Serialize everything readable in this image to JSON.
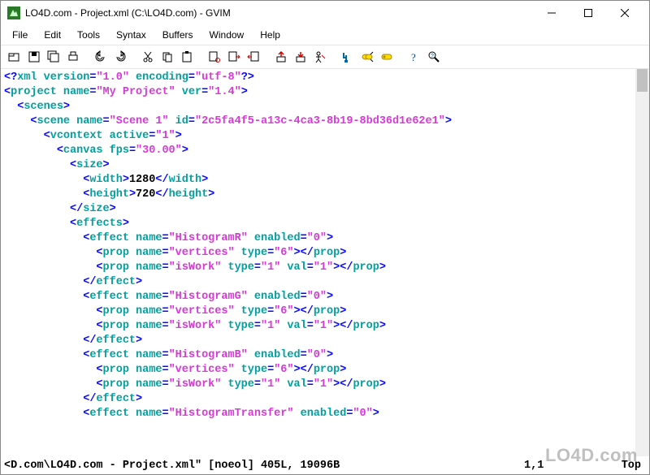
{
  "window": {
    "title": "LO4D.com - Project.xml (C:\\LO4D.com) - GVIM"
  },
  "menus": [
    "File",
    "Edit",
    "Tools",
    "Syntax",
    "Buffers",
    "Window",
    "Help"
  ],
  "toolbar_icons": [
    "open-file",
    "save-file",
    "save-all",
    "print",
    "sep",
    "undo",
    "redo",
    "sep",
    "cut",
    "copy",
    "paste",
    "sep",
    "find-replace",
    "find-next",
    "find-prev",
    "sep",
    "load-session",
    "save-session",
    "run-script",
    "sep",
    "build",
    "make-tags",
    "tag-jump",
    "sep",
    "help",
    "find-help"
  ],
  "code": {
    "lines": [
      {
        "indent": 0,
        "tokens": [
          [
            "pun",
            "<?"
          ],
          [
            "kw",
            "xml version"
          ],
          [
            "pun",
            "="
          ],
          [
            "str",
            "\"1.0\""
          ],
          [
            "kw",
            " encoding"
          ],
          [
            "pun",
            "="
          ],
          [
            "str",
            "\"utf-8\""
          ],
          [
            "pun",
            "?>"
          ]
        ]
      },
      {
        "indent": 0,
        "tokens": [
          [
            "pun",
            "<"
          ],
          [
            "kw",
            "project name"
          ],
          [
            "pun",
            "="
          ],
          [
            "str",
            "\"My Project\""
          ],
          [
            "kw",
            " ver"
          ],
          [
            "pun",
            "="
          ],
          [
            "str",
            "\"1.4\""
          ],
          [
            "pun",
            ">"
          ]
        ]
      },
      {
        "indent": 1,
        "tokens": [
          [
            "pun",
            "<"
          ],
          [
            "kw",
            "scenes"
          ],
          [
            "pun",
            ">"
          ]
        ]
      },
      {
        "indent": 2,
        "tokens": [
          [
            "pun",
            "<"
          ],
          [
            "kw",
            "scene name"
          ],
          [
            "pun",
            "="
          ],
          [
            "str",
            "\"Scene 1\""
          ],
          [
            "kw",
            " id"
          ],
          [
            "pun",
            "="
          ],
          [
            "str",
            "\"2c5fa4f5-a13c-4ca3-8b19-8bd36d1e62e1\""
          ],
          [
            "pun",
            ">"
          ]
        ]
      },
      {
        "indent": 3,
        "tokens": [
          [
            "pun",
            "<"
          ],
          [
            "kw",
            "vcontext active"
          ],
          [
            "pun",
            "="
          ],
          [
            "str",
            "\"1\""
          ],
          [
            "pun",
            ">"
          ]
        ]
      },
      {
        "indent": 4,
        "tokens": [
          [
            "pun",
            "<"
          ],
          [
            "kw",
            "canvas fps"
          ],
          [
            "pun",
            "="
          ],
          [
            "str",
            "\"30.00\""
          ],
          [
            "pun",
            ">"
          ]
        ]
      },
      {
        "indent": 5,
        "tokens": [
          [
            "pun",
            "<"
          ],
          [
            "kw",
            "size"
          ],
          [
            "pun",
            ">"
          ]
        ]
      },
      {
        "indent": 6,
        "tokens": [
          [
            "pun",
            "<"
          ],
          [
            "kw",
            "width"
          ],
          [
            "pun",
            ">"
          ],
          [
            "txt",
            "1280"
          ],
          [
            "pun",
            "</"
          ],
          [
            "kw",
            "width"
          ],
          [
            "pun",
            ">"
          ]
        ]
      },
      {
        "indent": 6,
        "tokens": [
          [
            "pun",
            "<"
          ],
          [
            "kw",
            "height"
          ],
          [
            "pun",
            ">"
          ],
          [
            "txt",
            "720"
          ],
          [
            "pun",
            "</"
          ],
          [
            "kw",
            "height"
          ],
          [
            "pun",
            ">"
          ]
        ]
      },
      {
        "indent": 5,
        "tokens": [
          [
            "pun",
            "</"
          ],
          [
            "kw",
            "size"
          ],
          [
            "pun",
            ">"
          ]
        ]
      },
      {
        "indent": 5,
        "tokens": [
          [
            "pun",
            "<"
          ],
          [
            "kw",
            "effects"
          ],
          [
            "pun",
            ">"
          ]
        ]
      },
      {
        "indent": 6,
        "tokens": [
          [
            "pun",
            "<"
          ],
          [
            "kw",
            "effect name"
          ],
          [
            "pun",
            "="
          ],
          [
            "str",
            "\"HistogramR\""
          ],
          [
            "kw",
            " enabled"
          ],
          [
            "pun",
            "="
          ],
          [
            "str",
            "\"0\""
          ],
          [
            "pun",
            ">"
          ]
        ]
      },
      {
        "indent": 7,
        "tokens": [
          [
            "pun",
            "<"
          ],
          [
            "kw",
            "prop name"
          ],
          [
            "pun",
            "="
          ],
          [
            "str",
            "\"vertices\""
          ],
          [
            "kw",
            " type"
          ],
          [
            "pun",
            "="
          ],
          [
            "str",
            "\"6\""
          ],
          [
            "pun",
            "></"
          ],
          [
            "kw",
            "prop"
          ],
          [
            "pun",
            ">"
          ]
        ]
      },
      {
        "indent": 7,
        "tokens": [
          [
            "pun",
            "<"
          ],
          [
            "kw",
            "prop name"
          ],
          [
            "pun",
            "="
          ],
          [
            "str",
            "\"isWork\""
          ],
          [
            "kw",
            " type"
          ],
          [
            "pun",
            "="
          ],
          [
            "str",
            "\"1\""
          ],
          [
            "kw",
            " val"
          ],
          [
            "pun",
            "="
          ],
          [
            "str",
            "\"1\""
          ],
          [
            "pun",
            "></"
          ],
          [
            "kw",
            "prop"
          ],
          [
            "pun",
            ">"
          ]
        ]
      },
      {
        "indent": 6,
        "tokens": [
          [
            "pun",
            "</"
          ],
          [
            "kw",
            "effect"
          ],
          [
            "pun",
            ">"
          ]
        ]
      },
      {
        "indent": 6,
        "tokens": [
          [
            "pun",
            "<"
          ],
          [
            "kw",
            "effect name"
          ],
          [
            "pun",
            "="
          ],
          [
            "str",
            "\"HistogramG\""
          ],
          [
            "kw",
            " enabled"
          ],
          [
            "pun",
            "="
          ],
          [
            "str",
            "\"0\""
          ],
          [
            "pun",
            ">"
          ]
        ]
      },
      {
        "indent": 7,
        "tokens": [
          [
            "pun",
            "<"
          ],
          [
            "kw",
            "prop name"
          ],
          [
            "pun",
            "="
          ],
          [
            "str",
            "\"vertices\""
          ],
          [
            "kw",
            " type"
          ],
          [
            "pun",
            "="
          ],
          [
            "str",
            "\"6\""
          ],
          [
            "pun",
            "></"
          ],
          [
            "kw",
            "prop"
          ],
          [
            "pun",
            ">"
          ]
        ]
      },
      {
        "indent": 7,
        "tokens": [
          [
            "pun",
            "<"
          ],
          [
            "kw",
            "prop name"
          ],
          [
            "pun",
            "="
          ],
          [
            "str",
            "\"isWork\""
          ],
          [
            "kw",
            " type"
          ],
          [
            "pun",
            "="
          ],
          [
            "str",
            "\"1\""
          ],
          [
            "kw",
            " val"
          ],
          [
            "pun",
            "="
          ],
          [
            "str",
            "\"1\""
          ],
          [
            "pun",
            "></"
          ],
          [
            "kw",
            "prop"
          ],
          [
            "pun",
            ">"
          ]
        ]
      },
      {
        "indent": 6,
        "tokens": [
          [
            "pun",
            "</"
          ],
          [
            "kw",
            "effect"
          ],
          [
            "pun",
            ">"
          ]
        ]
      },
      {
        "indent": 6,
        "tokens": [
          [
            "pun",
            "<"
          ],
          [
            "kw",
            "effect name"
          ],
          [
            "pun",
            "="
          ],
          [
            "str",
            "\"HistogramB\""
          ],
          [
            "kw",
            " enabled"
          ],
          [
            "pun",
            "="
          ],
          [
            "str",
            "\"0\""
          ],
          [
            "pun",
            ">"
          ]
        ]
      },
      {
        "indent": 7,
        "tokens": [
          [
            "pun",
            "<"
          ],
          [
            "kw",
            "prop name"
          ],
          [
            "pun",
            "="
          ],
          [
            "str",
            "\"vertices\""
          ],
          [
            "kw",
            " type"
          ],
          [
            "pun",
            "="
          ],
          [
            "str",
            "\"6\""
          ],
          [
            "pun",
            "></"
          ],
          [
            "kw",
            "prop"
          ],
          [
            "pun",
            ">"
          ]
        ]
      },
      {
        "indent": 7,
        "tokens": [
          [
            "pun",
            "<"
          ],
          [
            "kw",
            "prop name"
          ],
          [
            "pun",
            "="
          ],
          [
            "str",
            "\"isWork\""
          ],
          [
            "kw",
            " type"
          ],
          [
            "pun",
            "="
          ],
          [
            "str",
            "\"1\""
          ],
          [
            "kw",
            " val"
          ],
          [
            "pun",
            "="
          ],
          [
            "str",
            "\"1\""
          ],
          [
            "pun",
            "></"
          ],
          [
            "kw",
            "prop"
          ],
          [
            "pun",
            ">"
          ]
        ]
      },
      {
        "indent": 6,
        "tokens": [
          [
            "pun",
            "</"
          ],
          [
            "kw",
            "effect"
          ],
          [
            "pun",
            ">"
          ]
        ]
      },
      {
        "indent": 6,
        "tokens": [
          [
            "pun",
            "<"
          ],
          [
            "kw",
            "effect name"
          ],
          [
            "pun",
            "="
          ],
          [
            "str",
            "\"HistogramTransfer\""
          ],
          [
            "kw",
            " enabled"
          ],
          [
            "pun",
            "="
          ],
          [
            "str",
            "\"0\""
          ],
          [
            "pun",
            ">"
          ]
        ]
      }
    ]
  },
  "status": {
    "left": "<D.com\\LO4D.com - Project.xml\" [noeol] 405L, 19096B",
    "pos": "1,1",
    "scroll": "Top"
  },
  "watermark": "LO4D.com"
}
